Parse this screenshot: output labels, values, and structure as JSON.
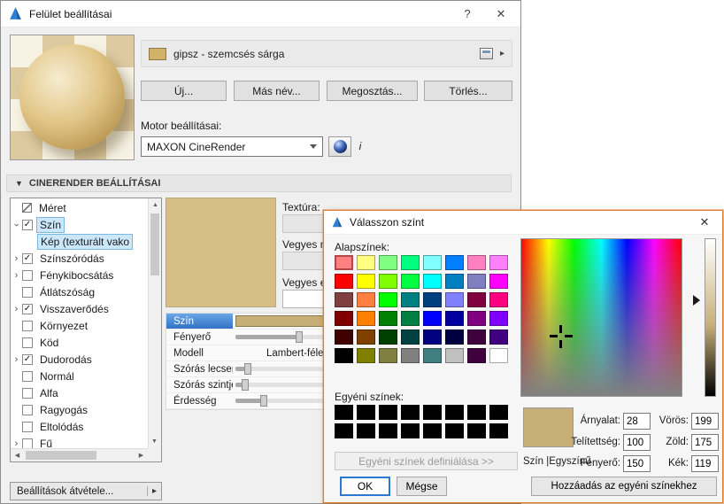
{
  "window": {
    "title": "Felület beállításai",
    "help": "?",
    "close": "✕"
  },
  "material": {
    "name": "gipsz - szemcsés sárga",
    "chip_color": "#d2b169"
  },
  "actions": {
    "new": "Új...",
    "rename": "Más név...",
    "share": "Megosztás...",
    "delete": "Törlés..."
  },
  "engine": {
    "label": "Motor beállításai:",
    "selected": "MAXON CineRender",
    "info": "i"
  },
  "section": {
    "title": "CINERENDER BEÁLLÍTÁSAI"
  },
  "tree": {
    "items": [
      {
        "label": "Méret",
        "icon": true,
        "checked": null,
        "expander": null,
        "selected": false,
        "child": false
      },
      {
        "label": "Szín",
        "icon": false,
        "checked": true,
        "expander": "open",
        "selected": true,
        "child": false
      },
      {
        "label": "Kép (texturált vako",
        "icon": false,
        "checked": null,
        "expander": null,
        "selected": true,
        "child": true
      },
      {
        "label": "Színszóródás",
        "icon": false,
        "checked": true,
        "expander": "closed",
        "selected": false,
        "child": false
      },
      {
        "label": "Fénykibocsátás",
        "icon": false,
        "checked": false,
        "expander": "closed",
        "selected": false,
        "child": false
      },
      {
        "label": "Átlátszóság",
        "icon": false,
        "checked": false,
        "expander": null,
        "selected": false,
        "child": false
      },
      {
        "label": "Visszaverődés",
        "icon": false,
        "checked": true,
        "expander": "closed",
        "selected": false,
        "child": false
      },
      {
        "label": "Környezet",
        "icon": false,
        "checked": false,
        "expander": null,
        "selected": false,
        "child": false
      },
      {
        "label": "Köd",
        "icon": false,
        "checked": false,
        "expander": null,
        "selected": false,
        "child": false
      },
      {
        "label": "Dudorodás",
        "icon": false,
        "checked": true,
        "expander": "closed",
        "selected": false,
        "child": false
      },
      {
        "label": "Normál",
        "icon": false,
        "checked": false,
        "expander": null,
        "selected": false,
        "child": false
      },
      {
        "label": "Alfa",
        "icon": false,
        "checked": false,
        "expander": null,
        "selected": false,
        "child": false
      },
      {
        "label": "Ragyogás",
        "icon": false,
        "checked": false,
        "expander": null,
        "selected": false,
        "child": false
      },
      {
        "label": "Eltolódás",
        "icon": false,
        "checked": false,
        "expander": null,
        "selected": false,
        "child": false
      },
      {
        "label": "Fű",
        "icon": false,
        "checked": false,
        "expander": "closed",
        "selected": false,
        "child": false
      }
    ]
  },
  "channel_panel": {
    "texture_preview_color": "#d7bd86",
    "texture_label": "Textúra:",
    "mix_mode_label": "Vegyes mód",
    "mix_strength_label": "Vegyes erős...",
    "rows": [
      {
        "label": "Szín",
        "type": "color",
        "value_color": "#c7ae76",
        "selected": true
      },
      {
        "label": "Fényerő",
        "type": "slider",
        "fill": 60,
        "selected": false
      },
      {
        "label": "Modell",
        "type": "text",
        "value": "Lambert-féle",
        "selected": false
      },
      {
        "label": "Szórás lecsen...",
        "type": "slider",
        "fill": 12,
        "selected": false
      },
      {
        "label": "Szórás szintje",
        "type": "slider",
        "fill": 9,
        "selected": false
      },
      {
        "label": "Érdesség",
        "type": "slider",
        "fill": 27,
        "selected": false
      }
    ]
  },
  "transfer": {
    "label": "Beállítások átvétele..."
  },
  "color_dialog": {
    "title": "Válasszon színt",
    "close": "✕",
    "basic_label": "Alapszínek:",
    "custom_label": "Egyéni színek:",
    "define_button": "Egyéni színek definiálása >>",
    "ok": "OK",
    "cancel": "Mégse",
    "add_button": "Hozzáadás az egyéni színekhez",
    "mode_label": "Szín |Egyszínű",
    "current_color": "#c7af77",
    "fields": {
      "hue": {
        "label": "Árnyalat:",
        "value": "28"
      },
      "sat": {
        "label": "Telítettség:",
        "value": "100"
      },
      "lum": {
        "label": "Fényerő:",
        "value": "150"
      },
      "red": {
        "label": "Vörös:",
        "value": "199"
      },
      "green": {
        "label": "Zöld:",
        "value": "175"
      },
      "blue": {
        "label": "Kék:",
        "value": "119"
      }
    },
    "basic_colors": [
      "#FF8080",
      "#FFFF80",
      "#80FF80",
      "#00FF80",
      "#80FFFF",
      "#0080FF",
      "#FF80C0",
      "#FF80FF",
      "#FF0000",
      "#FFFF00",
      "#80FF00",
      "#00FF40",
      "#00FFFF",
      "#0080C0",
      "#8080C0",
      "#FF00FF",
      "#804040",
      "#FF8040",
      "#00FF00",
      "#008080",
      "#004080",
      "#8080FF",
      "#800040",
      "#FF0080",
      "#800000",
      "#FF8000",
      "#008000",
      "#008040",
      "#0000FF",
      "#0000A0",
      "#800080",
      "#8000FF",
      "#400000",
      "#804000",
      "#004000",
      "#004040",
      "#000080",
      "#000040",
      "#400040",
      "#400080",
      "#000000",
      "#808000",
      "#808040",
      "#808080",
      "#408080",
      "#C0C0C0",
      "#400040",
      "#FFFFFF"
    ],
    "custom_colors": [
      "#000000",
      "#000000",
      "#000000",
      "#000000",
      "#000000",
      "#000000",
      "#000000",
      "#000000",
      "#000000",
      "#000000",
      "#000000",
      "#000000",
      "#000000",
      "#000000",
      "#000000",
      "#000000"
    ]
  }
}
